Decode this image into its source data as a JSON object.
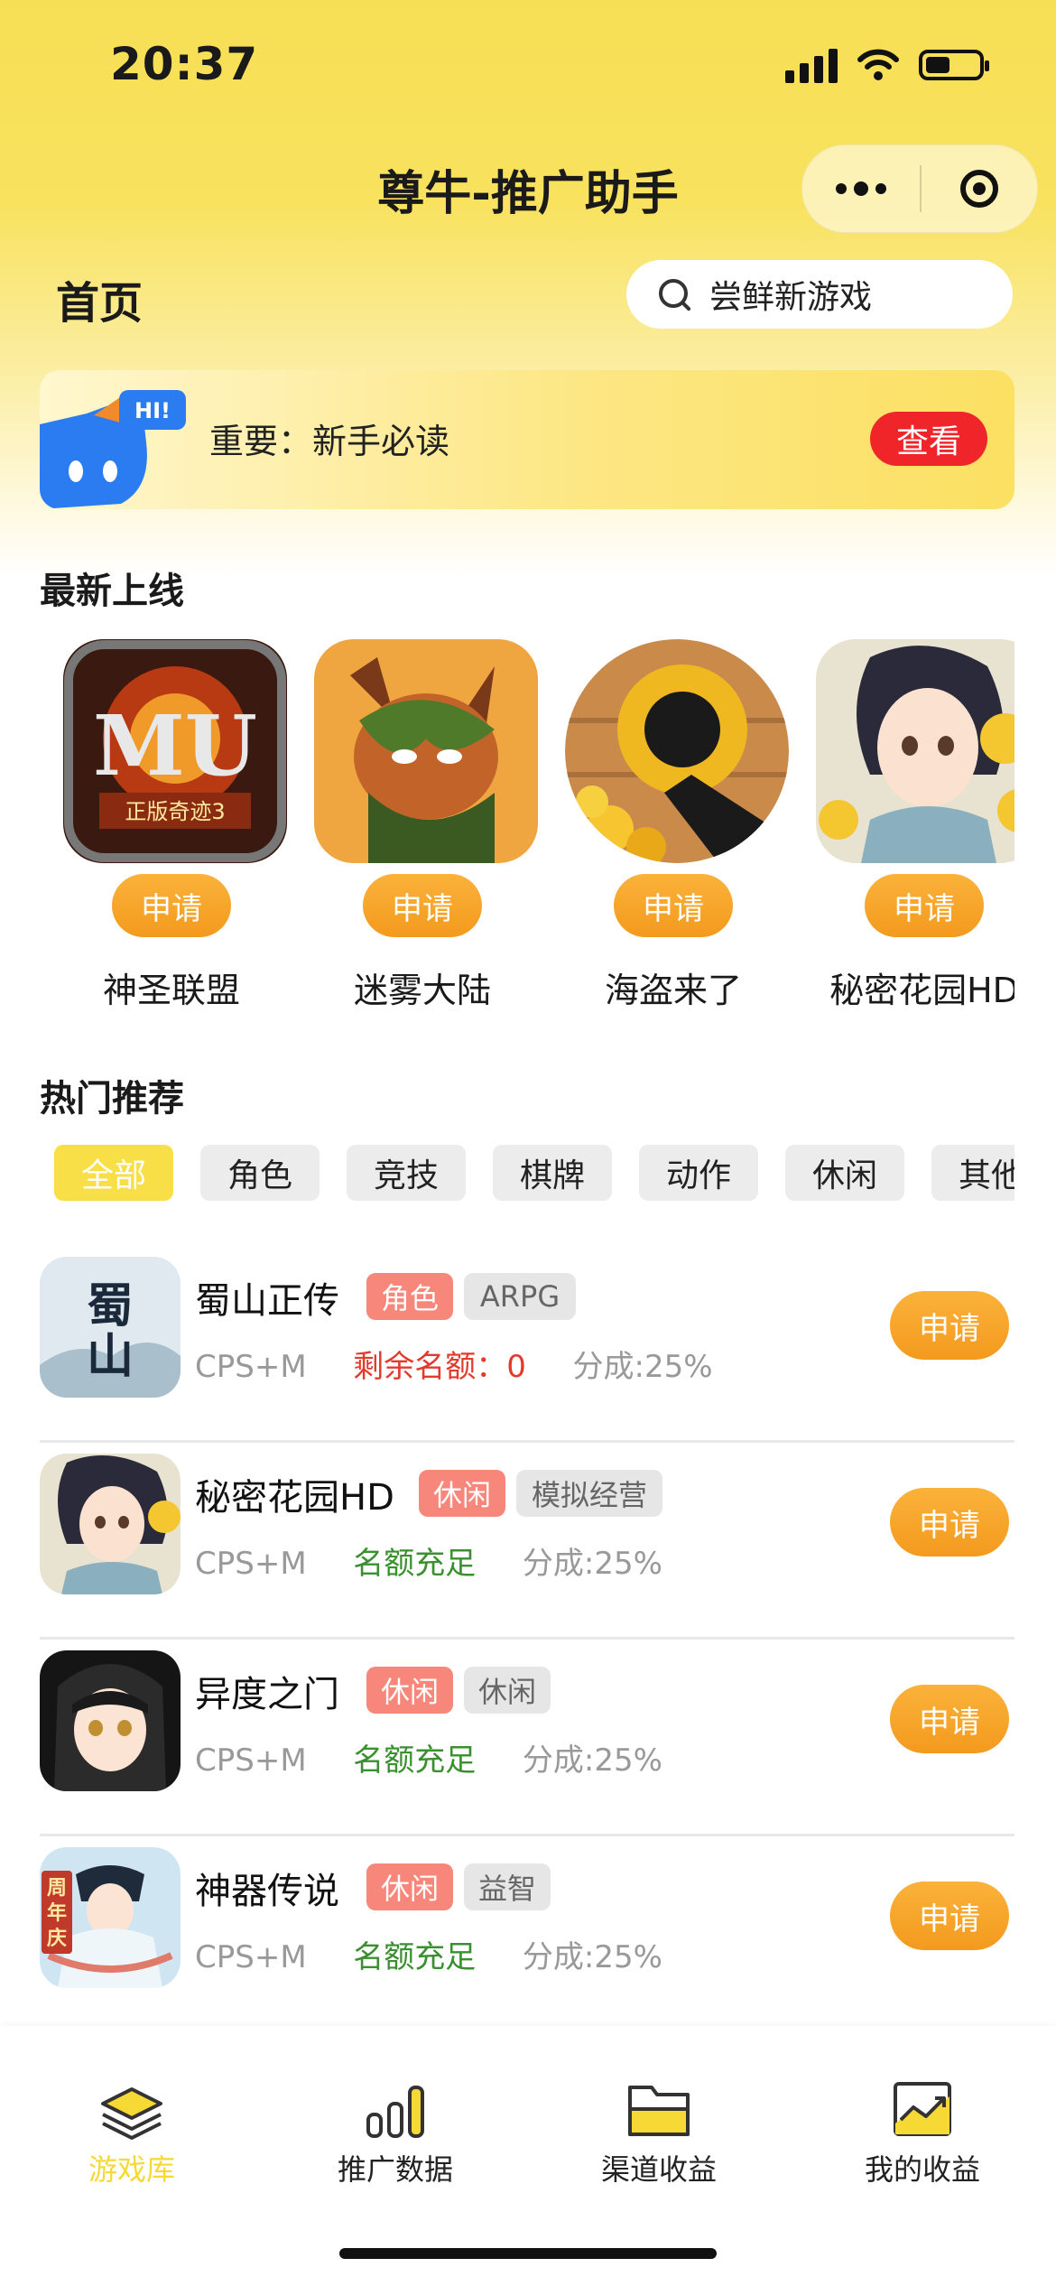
{
  "status_bar": {
    "time": "20:37"
  },
  "app": {
    "title": "尊牛-推广助手"
  },
  "header": {
    "page_title": "首页",
    "search_placeholder": "尝鲜新游戏"
  },
  "notice": {
    "badge": "HI!",
    "text": "重要：新手必读",
    "button": "查看"
  },
  "new_games": {
    "title": "最新上线",
    "items": [
      {
        "name": "神圣联盟",
        "button": "申请",
        "icon_text": "MU",
        "icon_sub": "正版奇迹3",
        "icon": "mu-game-icon"
      },
      {
        "name": "迷雾大陆",
        "button": "申请",
        "icon": "fox-warrior-icon"
      },
      {
        "name": "海盗来了",
        "button": "申请",
        "icon": "pirate-cannon-icon"
      },
      {
        "name": "秘密花园HD",
        "button": "申请",
        "icon": "garden-girl-icon"
      }
    ]
  },
  "hot": {
    "title": "热门推荐",
    "categories": [
      "全部",
      "角色",
      "竞技",
      "棋牌",
      "动作",
      "休闲",
      "其他"
    ],
    "games": [
      {
        "name": "蜀山正传",
        "tag1": "角色",
        "tag2": "ARPG",
        "model": "CPS+M",
        "quota": "剩余名额：0",
        "share": "分成:25%",
        "button": "申请",
        "icon_text": "蜀山"
      },
      {
        "name": "秘密花园HD",
        "tag1": "休闲",
        "tag2": "模拟经营",
        "model": "CPS+M",
        "quota": "名额充足",
        "share": "分成:25%",
        "button": "申请"
      },
      {
        "name": "异度之门",
        "tag1": "休闲",
        "tag2": "休闲",
        "model": "CPS+M",
        "quota": "名额充足",
        "share": "分成:25%",
        "button": "申请"
      },
      {
        "name": "神器传说",
        "tag1": "休闲",
        "tag2": "益智",
        "model": "CPS+M",
        "quota": "名额充足",
        "share": "分成:25%",
        "button": "申请",
        "icon_text": "周年庆"
      }
    ]
  },
  "tabbar": {
    "items": [
      {
        "label": "游戏库",
        "icon": "layers-icon",
        "active": true
      },
      {
        "label": "推广数据",
        "icon": "bar-chart-icon",
        "active": false
      },
      {
        "label": "渠道收益",
        "icon": "folder-icon",
        "active": false
      },
      {
        "label": "我的收益",
        "icon": "trend-chart-icon",
        "active": false
      }
    ]
  },
  "colors": {
    "brand_yellow": "#f8de47",
    "apply_orange": "#f39a1e",
    "alert_red": "#f0252a",
    "tag_red": "#f8877b",
    "quota_green": "#3a8f2f"
  }
}
